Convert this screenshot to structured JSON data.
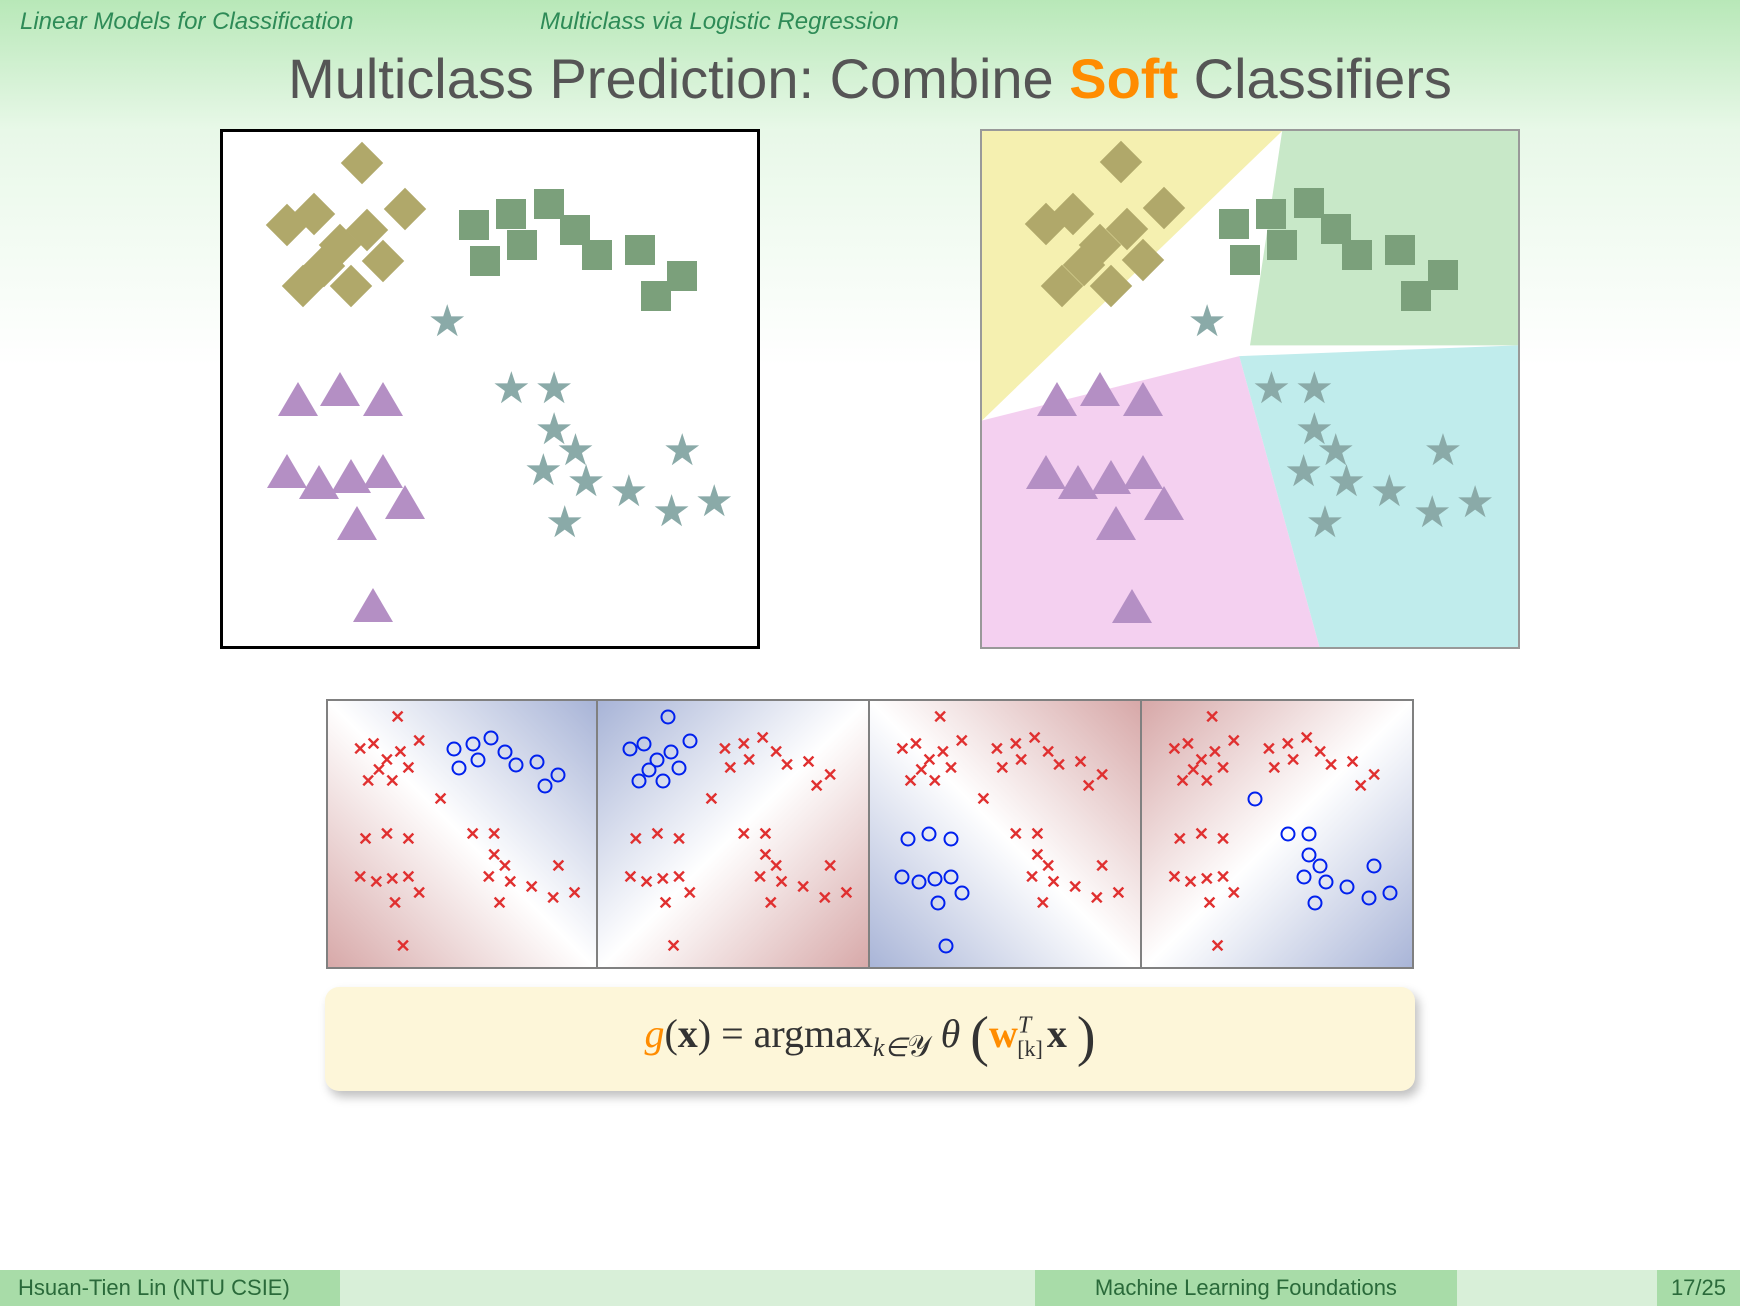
{
  "header": {
    "topic": "Linear Models for Classification",
    "subtopic": "Multiclass via Logistic Regression"
  },
  "title": {
    "pre": "Multiclass Prediction: Combine ",
    "accent": "Soft",
    "post": " Classifiers"
  },
  "formula": {
    "g": "g",
    "x1": "(",
    "xb": "x",
    "x2": ") = argmax",
    "sub_k": "k∈",
    "sub_y": "𝒴",
    "theta": " θ ",
    "lparen": "(",
    "w": "w",
    "wT": "T",
    "wk": "[k]",
    "xb2": "x",
    "rparen": ")"
  },
  "footer": {
    "author": "Hsuan-Tien Lin (NTU CSIE)",
    "course": "Machine Learning Foundations",
    "page": "17/25"
  },
  "chart_data": {
    "type": "scatter",
    "description": "Four-class 2D dataset shown twice (left plain, right with decision regions), plus four one-vs-all soft logistic classifiers below.",
    "classes": [
      "diamond",
      "square",
      "triangle",
      "star"
    ],
    "colors": {
      "diamond": "#b0a86a",
      "square": "#7ba07b",
      "triangle": "#b48fc4",
      "star": "#8aaaa8"
    },
    "region_colors": {
      "diamond": "#f5f0b0",
      "square": "#c8e8c8",
      "triangle": "#f4d0f0",
      "star": "#c0ecec"
    },
    "points_pct": {
      "diamond": [
        [
          26,
          6
        ],
        [
          12,
          18
        ],
        [
          17,
          16
        ],
        [
          22,
          22
        ],
        [
          27,
          19
        ],
        [
          19,
          26
        ],
        [
          24,
          30
        ],
        [
          30,
          25
        ],
        [
          15,
          30
        ],
        [
          34,
          15
        ]
      ],
      "square": [
        [
          47,
          18
        ],
        [
          54,
          16
        ],
        [
          61,
          14
        ],
        [
          66,
          19
        ],
        [
          56,
          22
        ],
        [
          49,
          25
        ],
        [
          70,
          24
        ],
        [
          78,
          23
        ],
        [
          86,
          28
        ],
        [
          81,
          32
        ]
      ],
      "triangle": [
        [
          14,
          52
        ],
        [
          22,
          50
        ],
        [
          30,
          52
        ],
        [
          12,
          66
        ],
        [
          18,
          68
        ],
        [
          24,
          67
        ],
        [
          30,
          66
        ],
        [
          25,
          76
        ],
        [
          34,
          72
        ],
        [
          28,
          92
        ]
      ],
      "star": [
        [
          42,
          37
        ],
        [
          54,
          50
        ],
        [
          62,
          50
        ],
        [
          62,
          58
        ],
        [
          66,
          62
        ],
        [
          60,
          66
        ],
        [
          68,
          68
        ],
        [
          76,
          70
        ],
        [
          84,
          74
        ],
        [
          86,
          62
        ],
        [
          92,
          72
        ],
        [
          64,
          76
        ]
      ]
    },
    "one_vs_all_panels": [
      {
        "positive": "square",
        "boundary": "diag-down",
        "blue_side": "upper-right"
      },
      {
        "positive": "diamond",
        "boundary": "diag-up",
        "blue_side": "upper-left"
      },
      {
        "positive": "triangle",
        "boundary": "diag-down",
        "blue_side": "lower-left"
      },
      {
        "positive": "star",
        "boundary": "diag-up",
        "blue_side": "lower-right"
      }
    ],
    "axes": {
      "xrange": [
        0,
        1
      ],
      "yrange": [
        0,
        1
      ],
      "grid": false
    }
  }
}
